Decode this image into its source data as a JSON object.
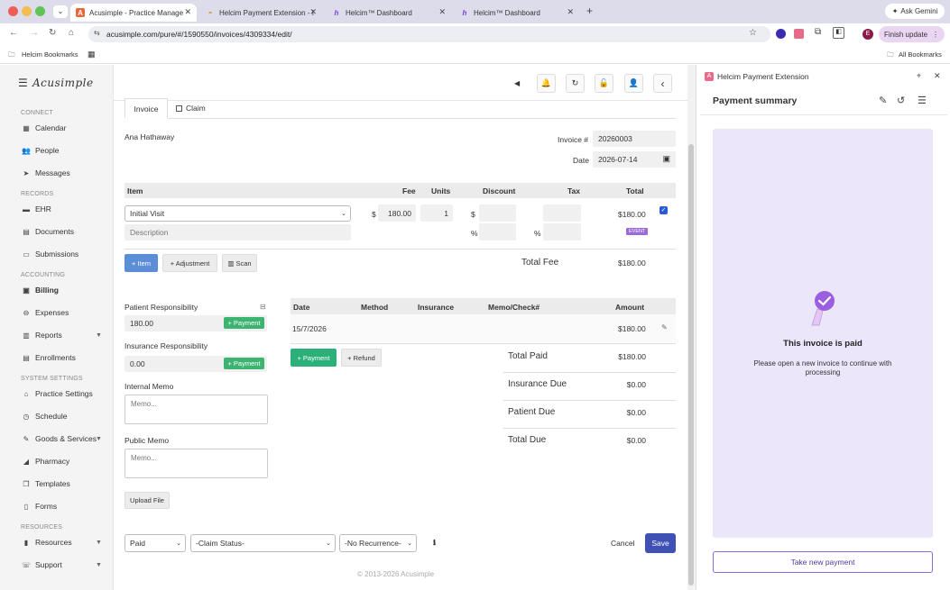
{
  "browser": {
    "tabs": [
      {
        "title": "Acusimple - Practice Manage",
        "active": true
      },
      {
        "title": "Helcim Payment Extension - I",
        "active": false
      },
      {
        "title": "Helcim™ Dashboard",
        "active": false
      },
      {
        "title": "Helcim™ Dashboard",
        "active": false
      }
    ],
    "ask_gemini": "Ask Gemini",
    "url": "acusimple.com/pure/#/1590550/invoices/4309334/edit/",
    "finish_update": "Finish update",
    "profile_initial": "E",
    "bookmarks": {
      "left": "Helcim Bookmarks",
      "right": "All Bookmarks"
    }
  },
  "app": {
    "logo": "Acusimple"
  },
  "sidebar": {
    "sections": [
      {
        "title": "CONNECT",
        "items": [
          {
            "label": "Calendar",
            "icon": "calendar-icon",
            "glyph": "▦"
          },
          {
            "label": "People",
            "icon": "people-icon",
            "glyph": "👥"
          },
          {
            "label": "Messages",
            "icon": "send-icon",
            "glyph": "➤"
          }
        ]
      },
      {
        "title": "RECORDS",
        "items": [
          {
            "label": "EHR",
            "icon": "folder-icon",
            "glyph": "▬"
          },
          {
            "label": "Documents",
            "icon": "briefcase-icon",
            "glyph": "▤"
          },
          {
            "label": "Submissions",
            "icon": "monitor-icon",
            "glyph": "▭"
          }
        ]
      },
      {
        "title": "ACCOUNTING",
        "items": [
          {
            "label": "Billing",
            "icon": "money-icon",
            "glyph": "▣",
            "active": true
          },
          {
            "label": "Expenses",
            "icon": "minus-circle-icon",
            "glyph": "⊖"
          },
          {
            "label": "Reports",
            "icon": "bar-chart-icon",
            "glyph": "▥",
            "caret": true
          },
          {
            "label": "Enrollments",
            "icon": "list-icon",
            "glyph": "▤"
          }
        ]
      },
      {
        "title": "SYSTEM SETTINGS",
        "items": [
          {
            "label": "Practice Settings",
            "icon": "home-icon",
            "glyph": "⌂"
          },
          {
            "label": "Schedule",
            "icon": "clock-icon",
            "glyph": "◷"
          },
          {
            "label": "Goods & Services",
            "icon": "tag-icon",
            "glyph": "✎",
            "caret": true
          },
          {
            "label": "Pharmacy",
            "icon": "pill-icon",
            "glyph": "◢"
          },
          {
            "label": "Templates",
            "icon": "copy-icon",
            "glyph": "❐"
          },
          {
            "label": "Forms",
            "icon": "file-icon",
            "glyph": "▯"
          }
        ]
      },
      {
        "title": "RESOURCES",
        "items": [
          {
            "label": "Resources",
            "icon": "book-icon",
            "glyph": "▮",
            "caret": true
          },
          {
            "label": "Support",
            "icon": "support-icon",
            "glyph": "☏",
            "caret": true
          }
        ]
      }
    ]
  },
  "invoice": {
    "tabs": [
      "Invoice",
      "Claim"
    ],
    "patient_name": "Ana Hathaway",
    "invoice_label": "Invoice #",
    "invoice_number": "20260003",
    "date_label": "Date",
    "date_value": "2026-07-14",
    "columns": [
      "Item",
      "Fee",
      "Units",
      "Discount",
      "Tax",
      "Total"
    ],
    "line_item": {
      "item": "Initial Visit",
      "description_placeholder": "Description",
      "currency": "$",
      "fee": "180.00",
      "units": "1",
      "discount_currency": "$",
      "percent": "%",
      "total": "$180.00",
      "event_badge": "EVENT",
      "checked": true
    },
    "buttons": {
      "item": "+ Item",
      "adjustment": "+ Adjustment",
      "scan": "Scan"
    },
    "total_fee_label": "Total Fee",
    "total_fee_value": "$180.00",
    "patient_responsibility_label": "Patient Responsibility",
    "patient_responsibility_value": "180.00",
    "insurance_responsibility_label": "Insurance Responsibility",
    "insurance_responsibility_value": "0.00",
    "payment_btn": "+ Payment",
    "internal_memo_label": "Internal Memo",
    "public_memo_label": "Public Memo",
    "memo_placeholder": "Memo...",
    "upload_file": "Upload File",
    "payments_columns": [
      "Date",
      "Method",
      "Insurance",
      "Memo/Check#",
      "Amount"
    ],
    "payment_row": {
      "date": "15/7/2026",
      "amount": "$180.00"
    },
    "refund_btn": "+ Refund",
    "totals": [
      {
        "label": "Total Paid",
        "value": "$180.00"
      },
      {
        "label": "Insurance Due",
        "value": "$0.00"
      },
      {
        "label": "Patient Due",
        "value": "$0.00"
      },
      {
        "label": "Total Due",
        "value": "$0.00"
      }
    ],
    "status_select": "Paid",
    "claim_status_select": "-Claim Status-",
    "recurrence_select": "-No Recurrence-",
    "cancel": "Cancel",
    "save": "Save",
    "footer": "© 2013-2026 Acusimple"
  },
  "extension": {
    "header_title": "Helcim Payment Extension",
    "summary_title": "Payment summary",
    "paid_title": "This invoice is paid",
    "paid_message": "Please open a new invoice to continue with processing",
    "take_new_payment": "Take new payment"
  },
  "colors": {
    "brand_blue": "#5b8ed6",
    "green": "#3cb371",
    "save": "#3f51b5",
    "purple": "#9b6bdb",
    "panel_bg": "#ece6fb"
  }
}
